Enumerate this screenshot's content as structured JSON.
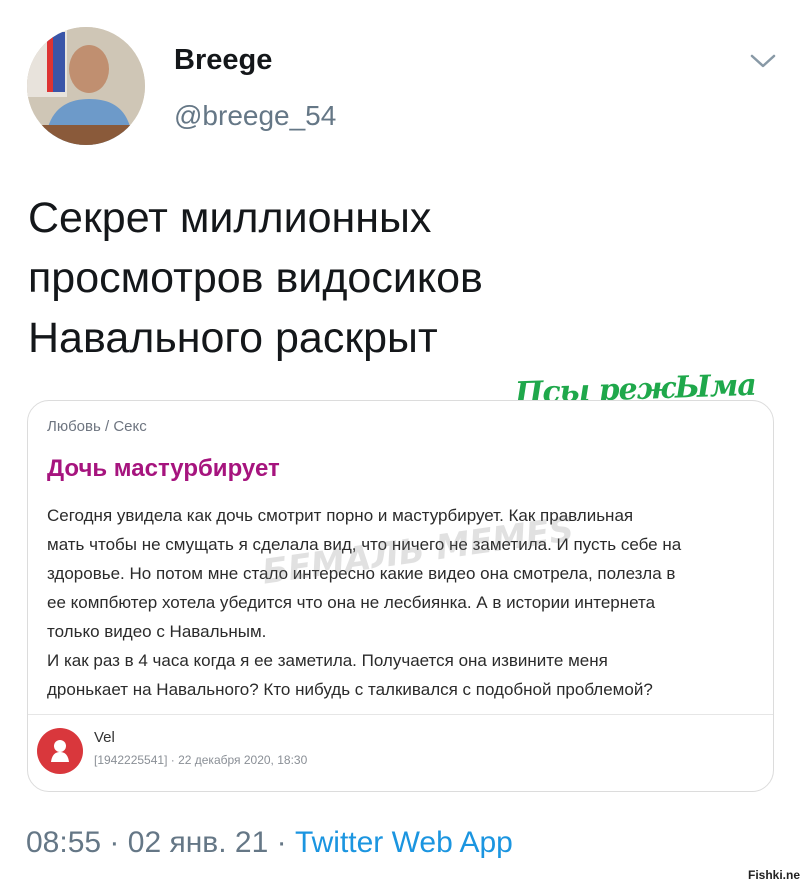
{
  "tweet": {
    "display_name": "Breege",
    "handle": "@breege_54",
    "text": "Секрет миллионных\nпросмотров видосиков\nНавального раскрыт",
    "avatar_icon": "user-photo",
    "menu_icon": "chevron-down-icon",
    "time": "08:55",
    "separator": "·",
    "date": "02 янв. 21",
    "source": "Twitter Web App"
  },
  "overlay": {
    "stamp": "Псы режЫма",
    "watermark": "БЕМАЛЬ MEMES",
    "site": "Fishki.net"
  },
  "card": {
    "category": "Любовь / Секс",
    "title": "Дочь мастурбирует",
    "body": "Сегодня увидела как дочь смотрит порно и мастурбирует. Как правлиьная\nмать чтобы не смущать я сделала вид, что ничего не заметила. И пусть себе на\nздоровье. Но потом мне стало интересно какие видео она смотрела, полезла в\nее компбютер хотела убедится что она не лесбиянка. А в истории интернета\nтолько видео с Навальным.\nИ как раз в 4 часа когда я ее заметила. Получается она извините меня\nдронькает на Навального? Кто нибудь с талкивался с подобной проблемой?",
    "author": "Vel",
    "meta": "[1942225541] · 22 декабря 2020, 18:30",
    "author_icon": "person-icon"
  },
  "colors": {
    "link": "#1b95e0",
    "title": "#a6147e",
    "stamp": "#1fa84b",
    "author_avatar": "#d9373c"
  }
}
